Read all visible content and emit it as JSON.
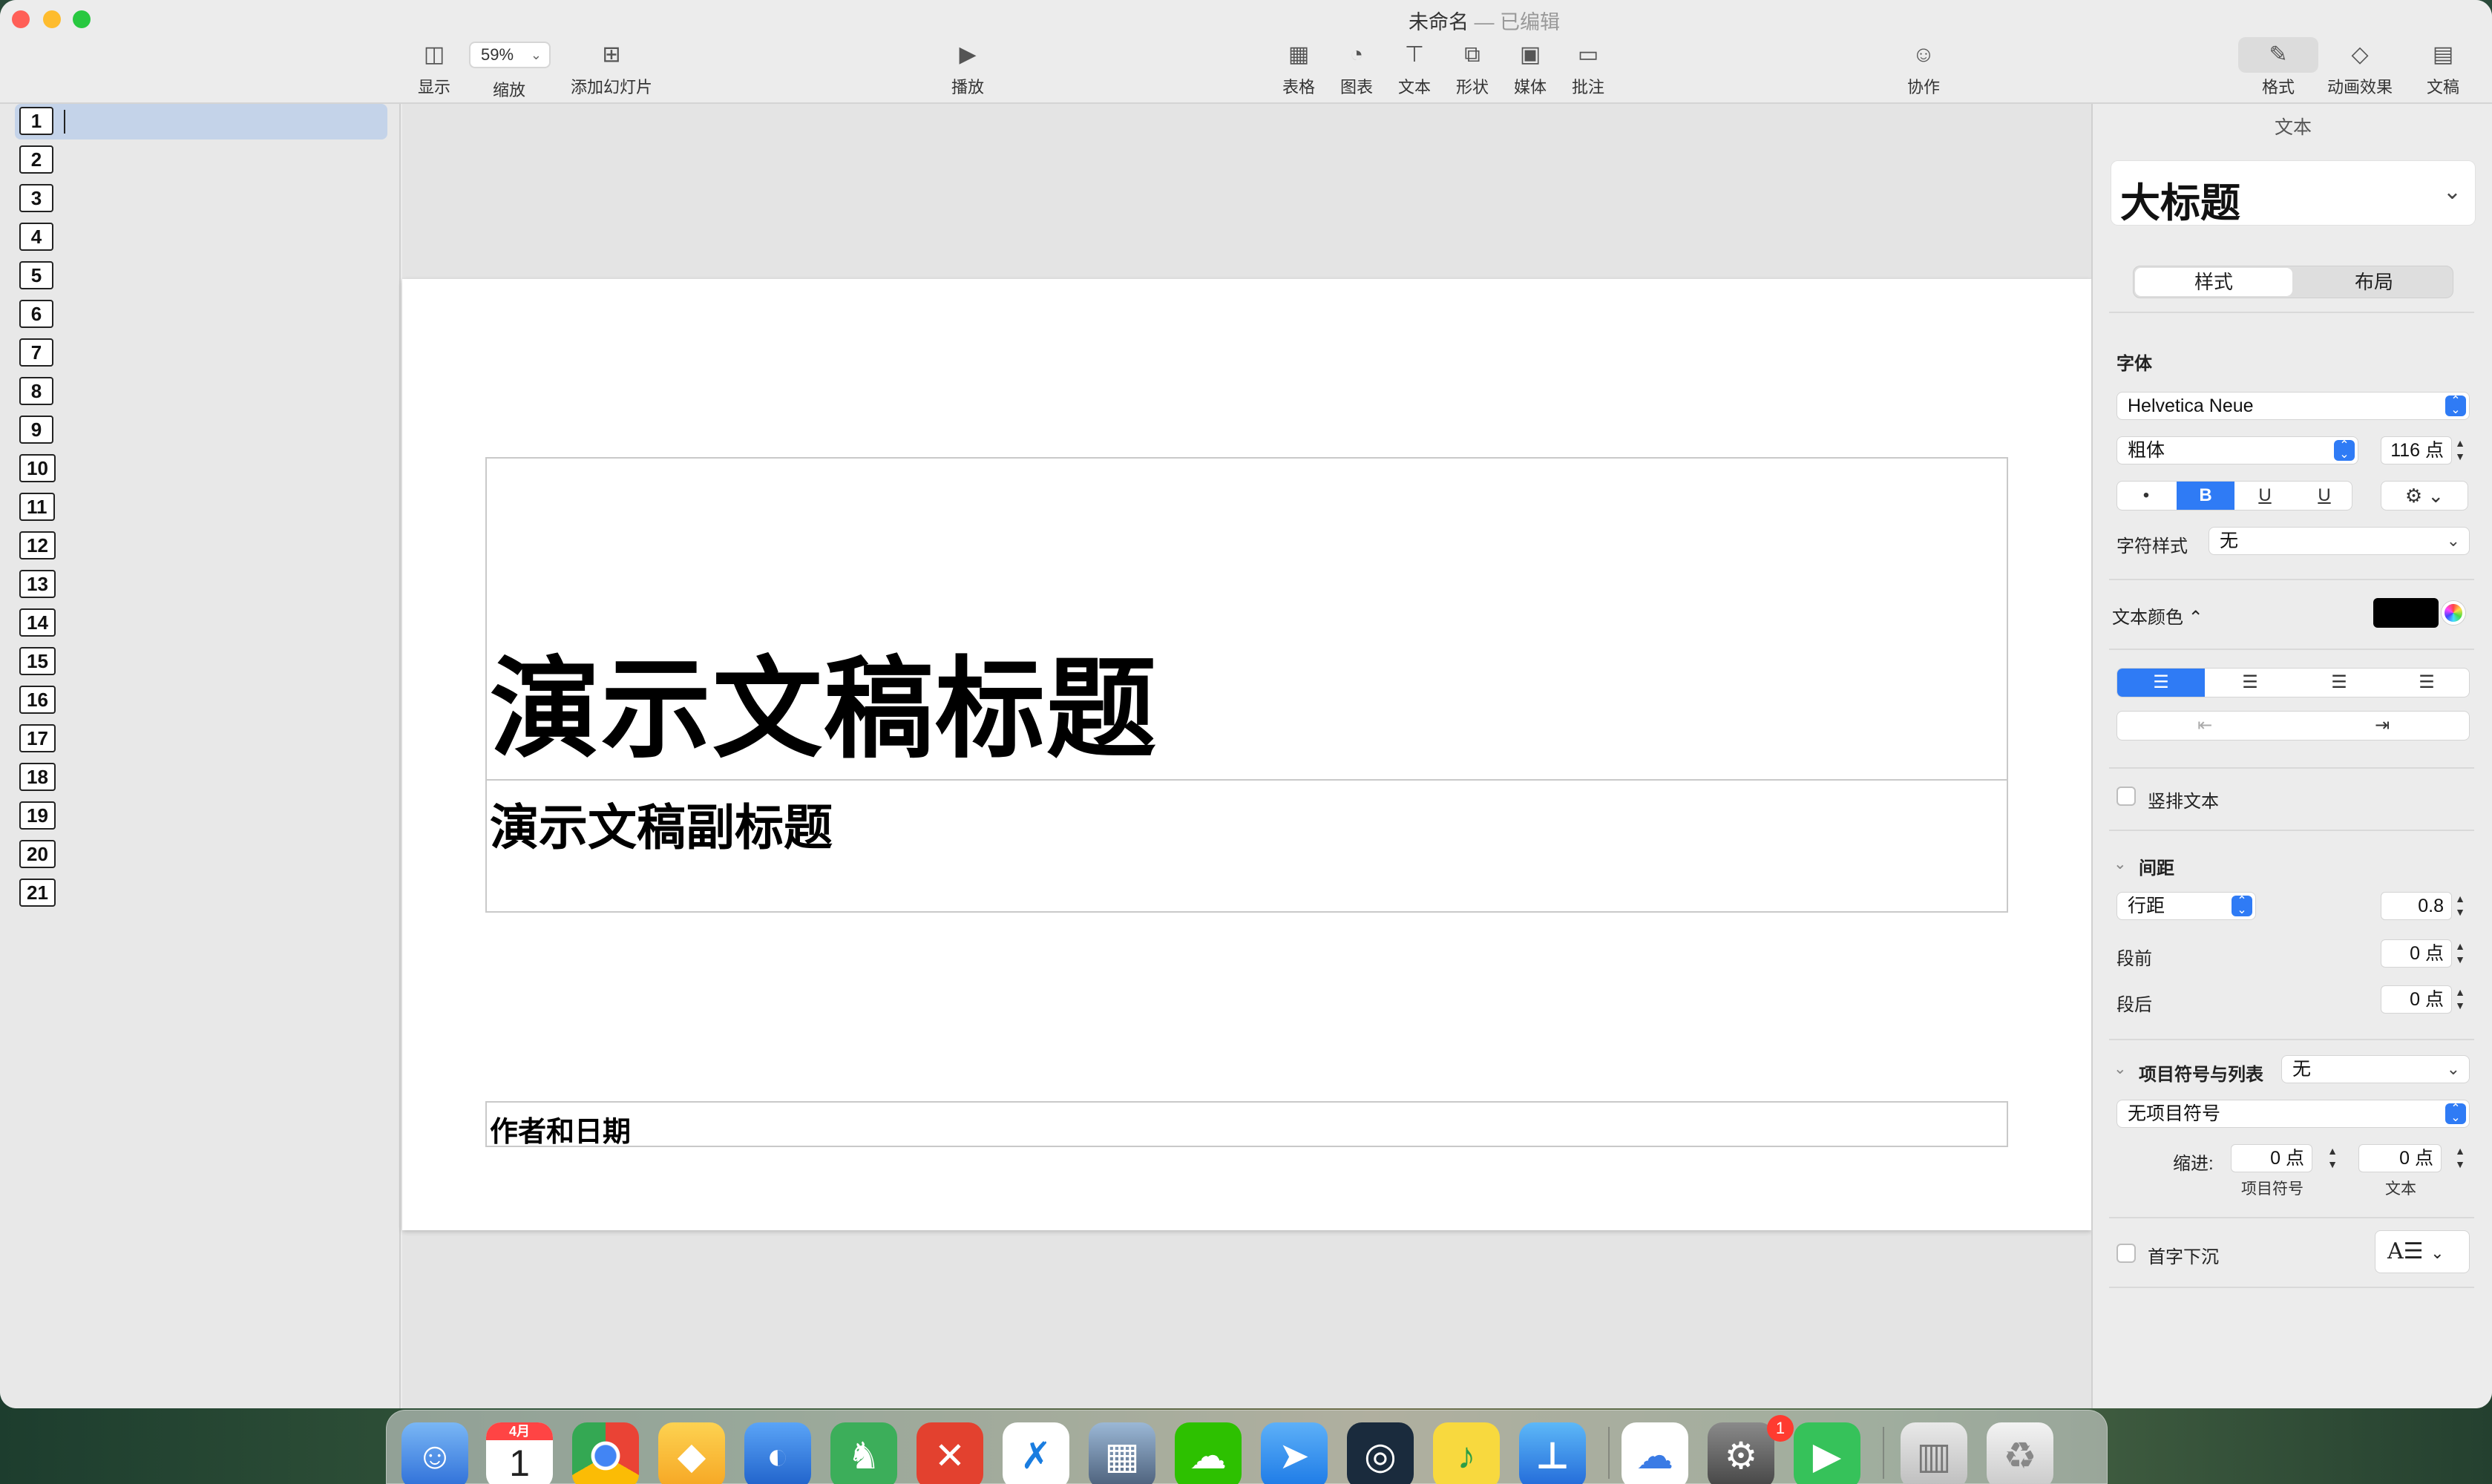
{
  "window": {
    "title": "未命名",
    "title_sep": "—",
    "title_status": "已编辑"
  },
  "toolbar": {
    "view_label": "显示",
    "zoom_value": "59%",
    "zoom_label": "缩放",
    "add_slide_label": "添加幻灯片",
    "play_label": "播放",
    "table_label": "表格",
    "chart_label": "图表",
    "text_label": "文本",
    "shape_label": "形状",
    "media_label": "媒体",
    "comment_label": "批注",
    "collaborate_label": "协作",
    "format_label": "格式",
    "animate_label": "动画效果",
    "document_label": "文稿"
  },
  "sidebar": {
    "slides": [
      "1",
      "2",
      "3",
      "4",
      "5",
      "6",
      "7",
      "8",
      "9",
      "10",
      "11",
      "12",
      "13",
      "14",
      "15",
      "16",
      "17",
      "18",
      "19",
      "20",
      "21"
    ],
    "selected": "1"
  },
  "slide": {
    "title": "演示文稿标题",
    "subtitle": "演示文稿副标题",
    "footer": "作者和日期"
  },
  "inspector": {
    "header": "文本",
    "paragraph_style": "大标题",
    "tab_style": "样式",
    "tab_layout": "布局",
    "font_section": "字体",
    "font_family": "Helvetica Neue",
    "font_weight": "粗体",
    "font_size": "116 点",
    "style_buttons": [
      "•",
      "B",
      "U",
      "U"
    ],
    "char_style_label": "字符样式",
    "char_style_value": "无",
    "text_color_label": "文本颜色 ⌃",
    "text_color": "#000000",
    "vertical_text_label": "竖排文本",
    "spacing_section": "间距",
    "line_spacing_type": "行距",
    "line_spacing_value": "0.8",
    "before_label": "段前",
    "before_value": "0 点",
    "after_label": "段后",
    "after_value": "0 点",
    "bullets_section": "项目符号与列表",
    "bullets_value": "无",
    "bullet_type": "无项目符号",
    "indent_label": "缩进:",
    "indent_bullet_value": "0 点",
    "indent_text_value": "0 点",
    "indent_bullet_caption": "项目符号",
    "indent_text_caption": "文本",
    "dropcap_label": "首字下沉"
  },
  "dock": {
    "calendar_month": "4月",
    "calendar_day": "1",
    "settings_badge": "1"
  },
  "colors": {
    "accent": "#2f7bf5",
    "selection": "#c4d3e9"
  }
}
